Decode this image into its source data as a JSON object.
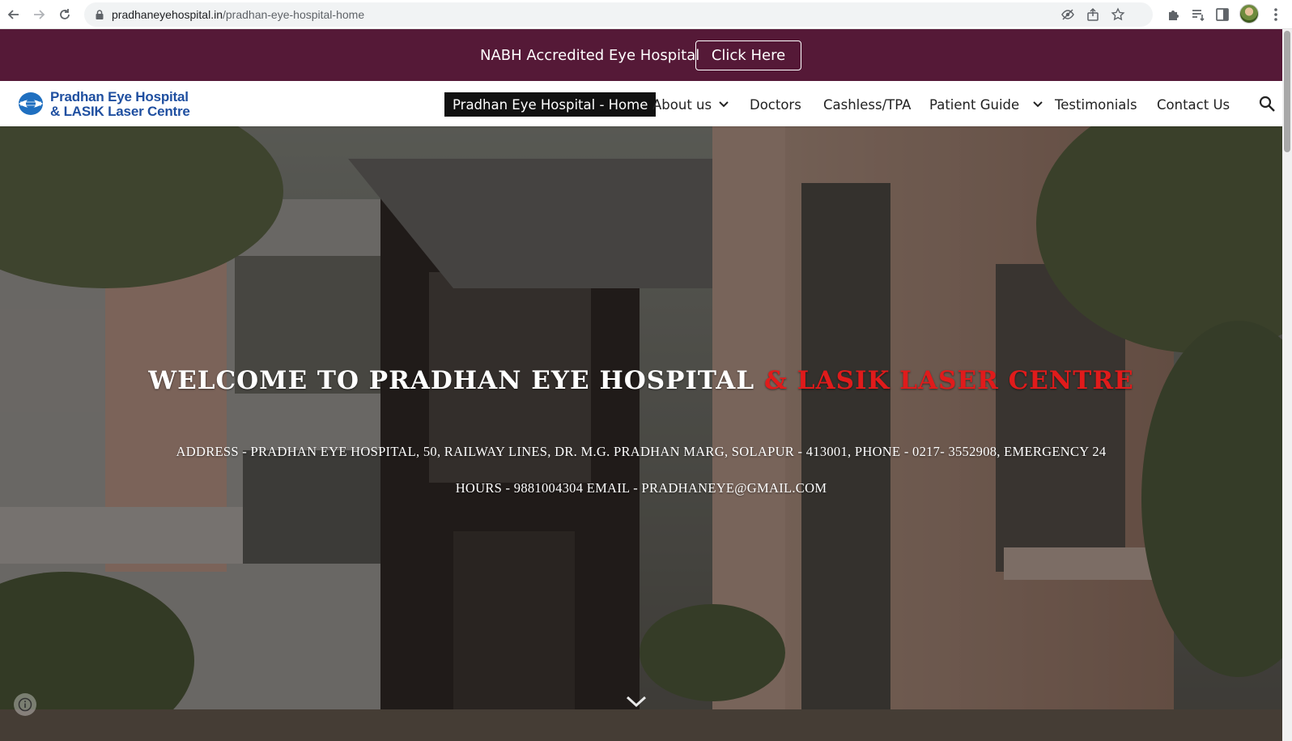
{
  "browser": {
    "url_host": "pradhaneyehospital.in",
    "url_path": "/pradhan-eye-hospital-home"
  },
  "banner": {
    "text": "NABH Accredited Eye Hospital",
    "button_label": "Click Here",
    "background": "#551937"
  },
  "header": {
    "logo_line1": "Pradhan Eye Hospital",
    "logo_line2": "& LASIK Laser Centre",
    "nav": [
      {
        "label": "Pradhan Eye Hospital - Home",
        "active": true
      },
      {
        "label": "About us",
        "dropdown": true
      },
      {
        "label": "Doctors"
      },
      {
        "label": "Cashless/TPA"
      },
      {
        "label": "Patient Guide",
        "dropdown": true
      },
      {
        "label": "Testimonials"
      },
      {
        "label": "Contact Us"
      }
    ]
  },
  "hero": {
    "title_white": "WELCOME TO PRADHAN EYE HOSPITAL ",
    "title_red": "& LASIK LASER CENTRE",
    "address_line1": "ADDRESS -  PRADHAN EYE HOSPITAL, 50, RAILWAY LINES, DR. M.G. PRADHAN MARG, SOLAPUR - 413001,  PHONE - 0217- 3552908, EMERGENCY 24",
    "address_line2": "HOURS - 9881004304 EMAIL - PRADHANEYE@GMAIL.COM",
    "accent_color": "#e01b1b"
  }
}
